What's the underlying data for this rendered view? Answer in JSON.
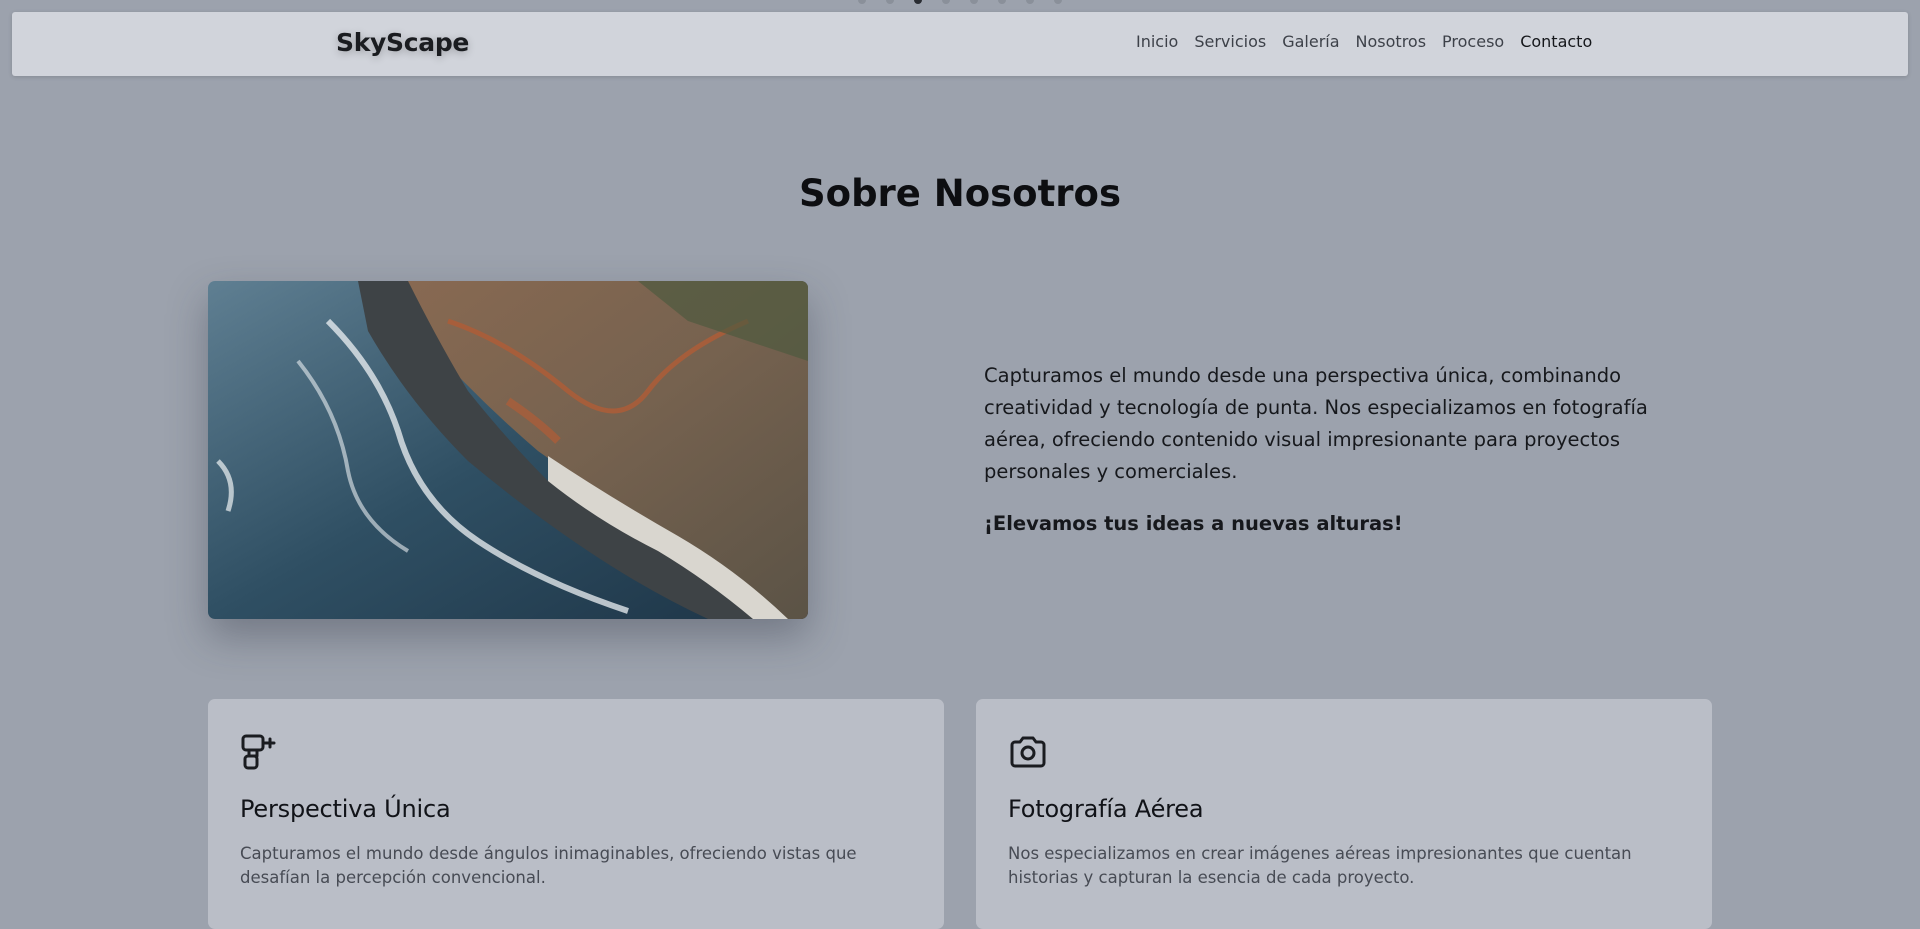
{
  "header": {
    "brand": "SkyScape",
    "nav": [
      "Inicio",
      "Servicios",
      "Galería",
      "Nosotros",
      "Proceso",
      "Contacto"
    ]
  },
  "about": {
    "title": "Sobre Nosotros",
    "paragraph": "Capturamos el mundo desde una perspectiva única, combinando creatividad y tecnología de punta. Nos especializamos en fotografía aérea, ofreciendo contenido visual impresionante para proyectos personales y comerciales.",
    "tagline": "¡Elevamos tus ideas a nuevas alturas!"
  },
  "features": [
    {
      "icon": "drone-icon",
      "title": "Perspectiva Única",
      "text": "Capturamos el mundo desde ángulos inimaginables, ofreciendo vistas que desafían la percepción convencional."
    },
    {
      "icon": "camera-icon",
      "title": "Fotografía Aérea",
      "text": "Nos especializamos en crear imágenes aéreas impresionantes que cuentan historias y capturan la esencia de cada proyecto."
    }
  ],
  "colors": {
    "background": "#9ca2ad",
    "navbar": "#d1d4db",
    "card": "#babec7"
  }
}
